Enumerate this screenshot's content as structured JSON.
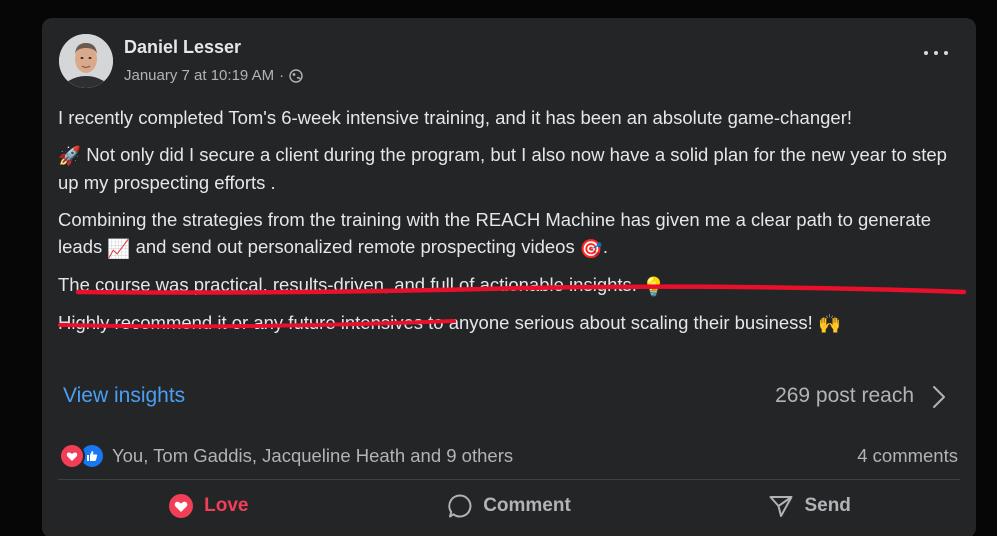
{
  "post": {
    "author": "Daniel Lesser",
    "timestamp": "January 7 at 10:19 AM",
    "separator": "·",
    "privacy_icon": "globe-icon",
    "more_icon": "more-dots-icon",
    "paragraphs": {
      "p1": "I recently completed Tom's 6-week intensive training, and it has been an absolute game-changer!",
      "p2_emoji": "🚀",
      "p2": "Not only did I secure a client during the program, but I also now have a solid plan for the new year to step up my prospecting efforts .",
      "p3a": "Combining the strategies from the training with the REACH Machine has given me a clear path to generate leads",
      "p3_emoji1": "📈",
      "p3b": "and send out personalized remote prospecting videos",
      "p3_emoji2": "🎯",
      "p3c": ".",
      "p4": "The course was practical, results-driven, and full of actionable insights.",
      "p4_emoji": "💡",
      "p5": "Highly recommend it or any future intensives to anyone serious about scaling their business!",
      "p5_emoji": "🙌"
    },
    "annotation_color": "#e8102a"
  },
  "insights": {
    "link_label": "View insights",
    "reach_label": "269 post reach",
    "chevron_icon": "chevron-right-icon",
    "link_color": "#4a9ff5"
  },
  "reactions": {
    "icons": [
      "love-reaction-icon",
      "like-reaction-icon"
    ],
    "names": "You, Tom Gaddis, Jacqueline Heath and 9 others",
    "comments": "4 comments"
  },
  "actions": {
    "love": {
      "label": "Love",
      "icon": "heart-icon",
      "color": "#f33e58"
    },
    "comment": {
      "label": "Comment",
      "icon": "comment-bubble-icon"
    },
    "send": {
      "label": "Send",
      "icon": "send-icon"
    }
  },
  "colors": {
    "card_bg": "#242526",
    "page_bg": "#060607",
    "text_primary": "#e4e6eb",
    "text_secondary": "#b0b3b8"
  }
}
